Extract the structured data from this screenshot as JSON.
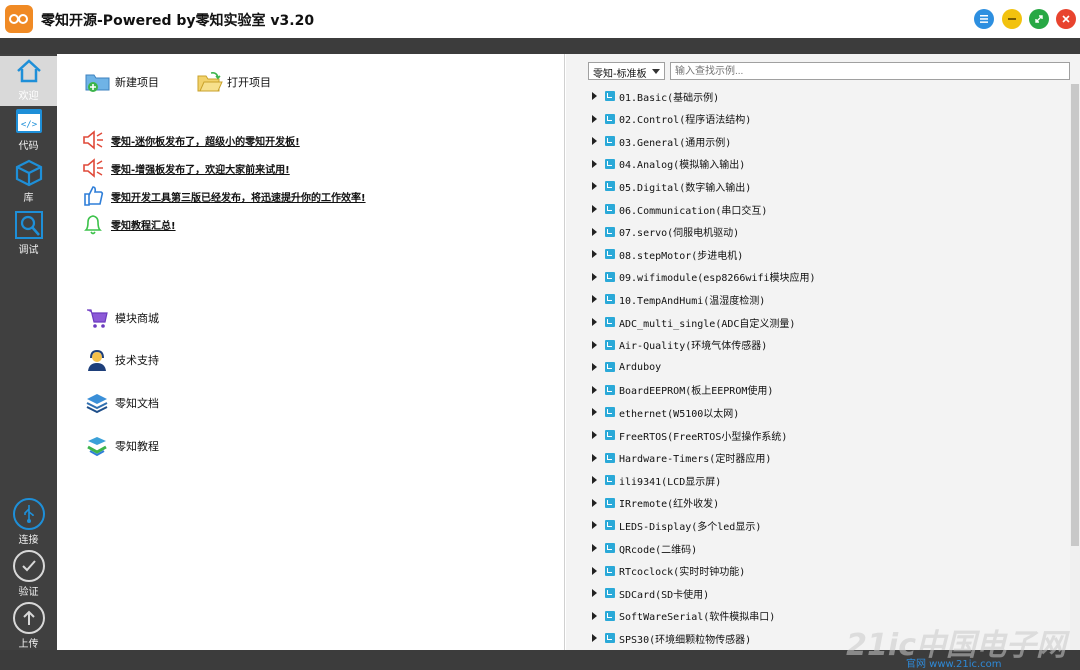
{
  "window": {
    "title": "零知开源-Powered by零知实验室 v3.20",
    "controls": [
      "menu",
      "minimize",
      "maximize",
      "close"
    ]
  },
  "colors": {
    "sidebar_bg": "#404040",
    "accent_blue": "#2aa9d8",
    "titlebar_logo": "#f08a24"
  },
  "sidebar": {
    "items": [
      {
        "label": "欢迎",
        "icon": "home-icon"
      },
      {
        "label": "代码",
        "icon": "code-icon"
      },
      {
        "label": "库",
        "icon": "cube-icon"
      },
      {
        "label": "调试",
        "icon": "debug-icon"
      }
    ],
    "bottom_items": [
      {
        "label": "连接",
        "icon": "usb-icon"
      },
      {
        "label": "验证",
        "icon": "check-icon"
      },
      {
        "label": "上传",
        "icon": "upload-arrow-icon"
      }
    ]
  },
  "welcome": {
    "new_project": "新建项目",
    "open_project": "打开项目",
    "news": [
      {
        "text": "零知-迷你板发布了，超级小的零知开发板!",
        "icon": "speaker-icon"
      },
      {
        "text": "零知-增强板发布了，欢迎大家前来试用!",
        "icon": "speaker-icon"
      },
      {
        "text": "零知开发工具第三版已经发布，将迅速提升你的工作效率!",
        "icon": "thumbs-up-icon"
      },
      {
        "text": "零知教程汇总!",
        "icon": "bell-icon"
      }
    ],
    "links": [
      {
        "text": "模块商城",
        "icon": "cart-icon"
      },
      {
        "text": "技术支持",
        "icon": "support-agent-icon"
      },
      {
        "text": "零知文档",
        "icon": "layers-icon"
      },
      {
        "text": "零知教程",
        "icon": "tutorial-icon"
      }
    ]
  },
  "examples": {
    "board_select": "零知-标准板",
    "search_placeholder": "输入查找示例...",
    "items": [
      "01.Basic(基础示例)",
      "02.Control(程序语法结构)",
      "03.General(通用示例)",
      "04.Analog(模拟输入输出)",
      "05.Digital(数字输入输出)",
      "06.Communication(串口交互)",
      "07.servo(伺服电机驱动)",
      "08.stepMotor(步进电机)",
      "09.wifimodule(esp8266wifi模块应用)",
      "10.TempAndHumi(温湿度检测)",
      "ADC_multi_single(ADC自定义测量)",
      "Air-Quality(环境气体传感器)",
      "Arduboy",
      "BoardEEPROM(板上EEPROM使用)",
      "ethernet(W5100以太网)",
      "FreeRTOS(FreeRTOS小型操作系统)",
      "Hardware-Timers(定时器应用)",
      "ili9341(LCD显示屏)",
      "IRremote(红外收发)",
      "LEDS-Display(多个led显示)",
      "QRcode(二维码)",
      "RTcoclock(实时时钟功能)",
      "SDCard(SD卡使用)",
      "SoftWareSerial(软件模拟串口)",
      "SPS30(环境细颗粒物传感器)"
    ]
  },
  "watermark": {
    "logo": "21ic中国电子网",
    "site": "官网 www.21ic.com"
  }
}
